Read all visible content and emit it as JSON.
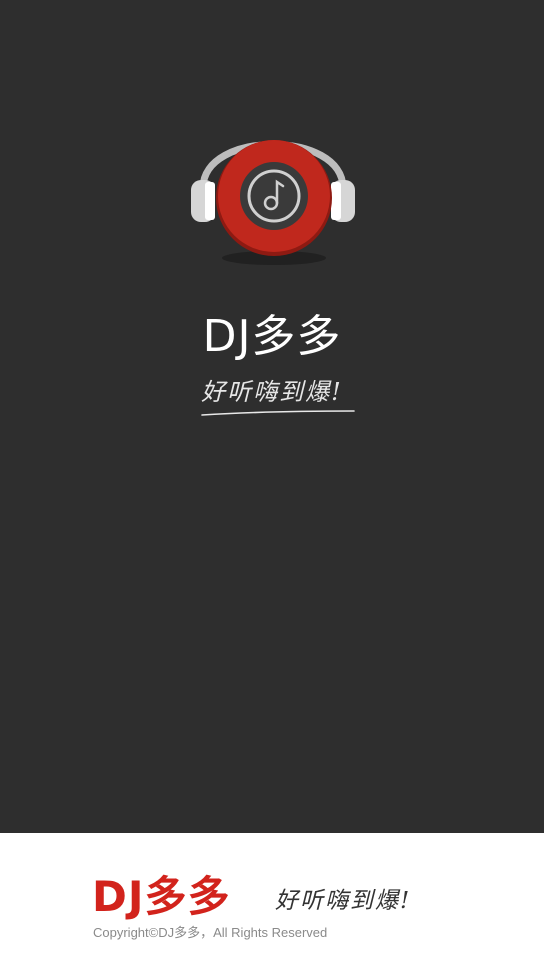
{
  "splash": {
    "app_name": "DJ多多",
    "slogan": "好听嗨到爆!",
    "logo_icon": "headphones-music-disc-icon"
  },
  "footer": {
    "brand": "DJ多多",
    "slogan": "好听嗨到爆!",
    "copyright": "Copyright©DJ多多，All Rights Reserved"
  },
  "colors": {
    "background": "#2e2e2e",
    "footer_background": "#ffffff",
    "brand_red": "#d2231c",
    "disc_red": "#c0281d",
    "headphone_gray": "#c8c8c8"
  }
}
